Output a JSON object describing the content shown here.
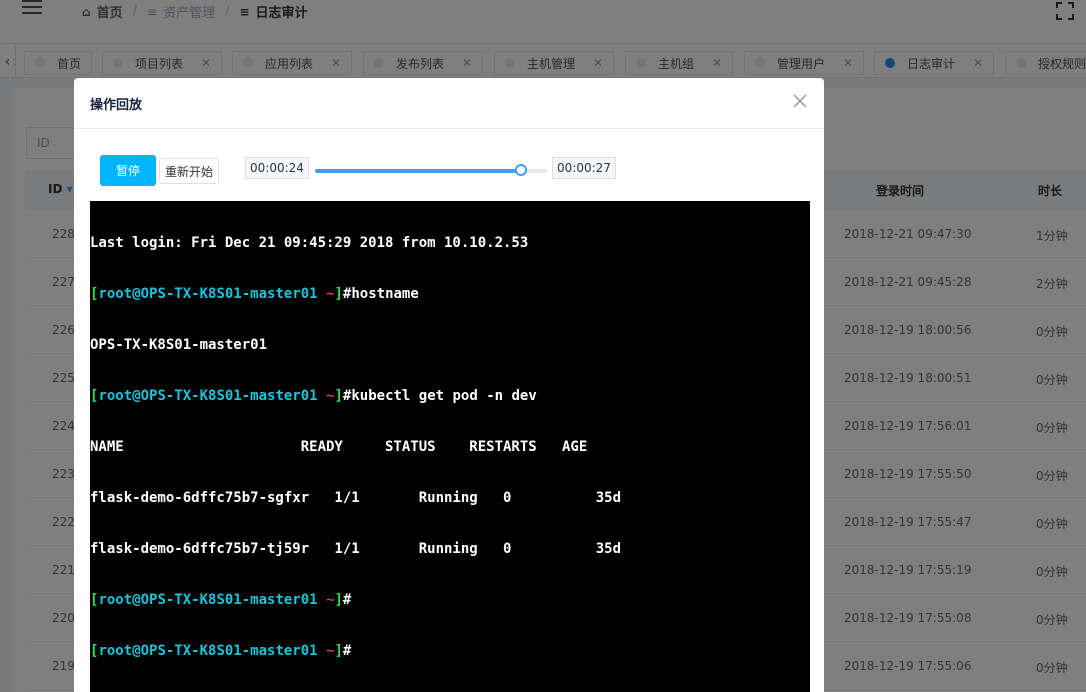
{
  "header": {
    "breadcrumb": [
      {
        "label": "首页",
        "icon": "home-icon"
      },
      {
        "label": "资产管理",
        "icon": "menu-icon"
      },
      {
        "label": "日志审计",
        "icon": "menu-icon"
      }
    ],
    "separator": "/"
  },
  "tabs": [
    {
      "label": "首页",
      "closable": false,
      "active": false
    },
    {
      "label": "项目列表",
      "closable": true,
      "active": false
    },
    {
      "label": "应用列表",
      "closable": true,
      "active": false
    },
    {
      "label": "发布列表",
      "closable": true,
      "active": false
    },
    {
      "label": "主机管理",
      "closable": true,
      "active": false
    },
    {
      "label": "主机组",
      "closable": true,
      "active": false
    },
    {
      "label": "管理用户",
      "closable": true,
      "active": false
    },
    {
      "label": "日志审计",
      "closable": true,
      "active": true
    },
    {
      "label": "授权规则",
      "closable": true,
      "active": false
    }
  ],
  "background_table": {
    "filter_placeholder": "ID",
    "columns": [
      "ID",
      "登录时间",
      "时长"
    ],
    "rows": [
      {
        "id": "228",
        "login_time": "2018-12-21 09:47:30",
        "duration": "1分钟"
      },
      {
        "id": "227",
        "login_time": "2018-12-21 09:45:28",
        "duration": "2分钟"
      },
      {
        "id": "226",
        "login_time": "2018-12-19 18:00:56",
        "duration": "0分钟"
      },
      {
        "id": "225",
        "login_time": "2018-12-19 18:00:51",
        "duration": "0分钟"
      },
      {
        "id": "224",
        "login_time": "2018-12-19 17:56:01",
        "duration": "0分钟"
      },
      {
        "id": "223",
        "login_time": "2018-12-19 17:55:50",
        "duration": "0分钟"
      },
      {
        "id": "222",
        "login_time": "2018-12-19 17:55:47",
        "duration": "0分钟"
      },
      {
        "id": "221",
        "login_time": "2018-12-19 17:55:19",
        "duration": "0分钟"
      },
      {
        "id": "220",
        "login_time": "2018-12-19 17:55:08",
        "duration": "0分钟"
      },
      {
        "id": "219",
        "login_time": "2018-12-19 17:55:06",
        "duration": "0分钟"
      }
    ]
  },
  "modal": {
    "title": "操作回放",
    "pause_label": "暂停",
    "restart_label": "重新开始",
    "current_time": "00:00:24",
    "total_time": "00:00:27",
    "progress": 0.89,
    "colors": {
      "accent": "#00b4ff",
      "slider": "#409eff"
    }
  },
  "terminal": {
    "last_login": "Last login: Fri Dec 21 09:45:29 2018 from 10.10.2.53",
    "prompt_user": "root",
    "prompt_host": "OPS-TX-K8S01-master01",
    "prompt_path": "~",
    "cmd1": "hostname",
    "out1": "OPS-TX-K8S01-master01",
    "cmd2": "kubectl get pod -n dev",
    "pod_header": "NAME                     READY     STATUS    RESTARTS   AGE",
    "pod_rows": [
      "flask-demo-6dffc75b7-sgfxr   1/1       Running   0          35d",
      "flask-demo-6dffc75b7-tj59r   1/1       Running   0          35d"
    ]
  }
}
